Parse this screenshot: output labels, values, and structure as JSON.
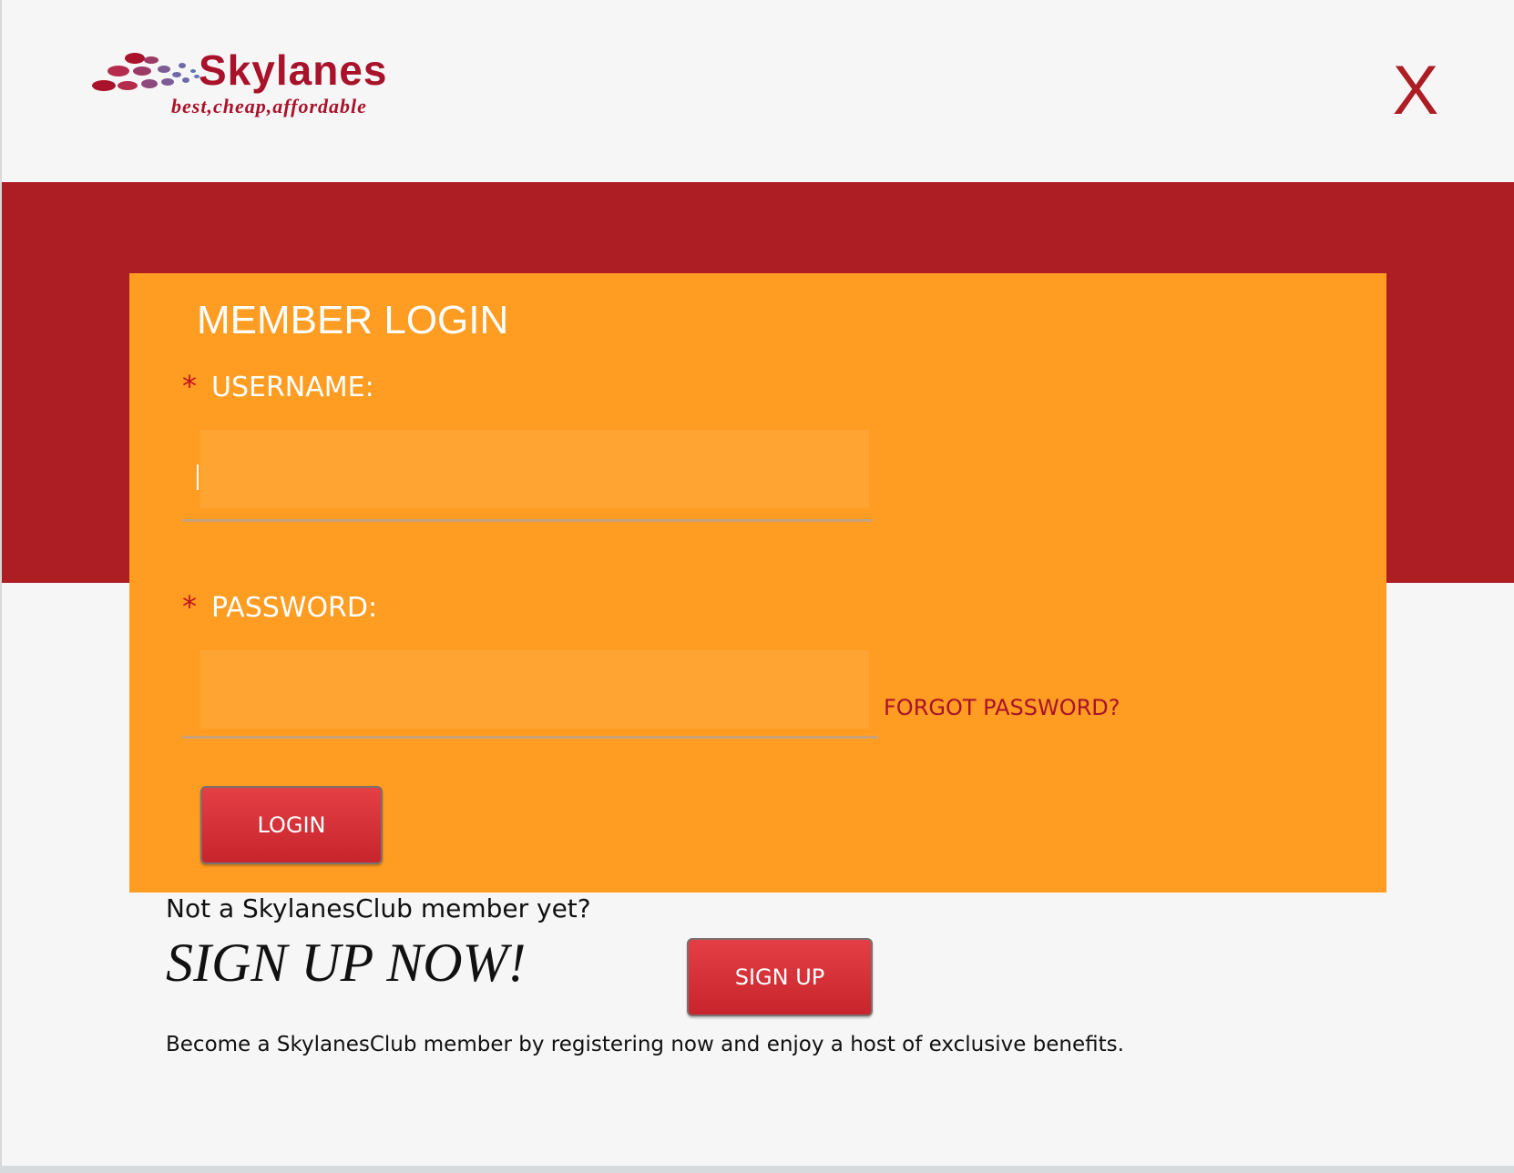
{
  "header": {
    "logo": {
      "name": "Skylanes",
      "tagline": "best,cheap,affordable"
    },
    "close_label": "X"
  },
  "login": {
    "title": "MEMBER LOGIN",
    "required_mark": "*",
    "username_label": "USERNAME:",
    "username_value": "",
    "password_label": "PASSWORD:",
    "password_value": "",
    "forgot_label": "FORGOT PASSWORD?",
    "login_button": "LOGIN"
  },
  "signup": {
    "prompt": "Not a SkylanesClub member yet?",
    "headline": "SIGN UP NOW!",
    "button": "SIGN UP",
    "description": "Become a SkylanesClub member by registering now and enjoy a host of exclusive benefits."
  },
  "colors": {
    "brand_red": "#ad1d24",
    "panel_orange": "#ff9c22",
    "button_red": "#d7343a",
    "background": "#f6f6f6"
  }
}
